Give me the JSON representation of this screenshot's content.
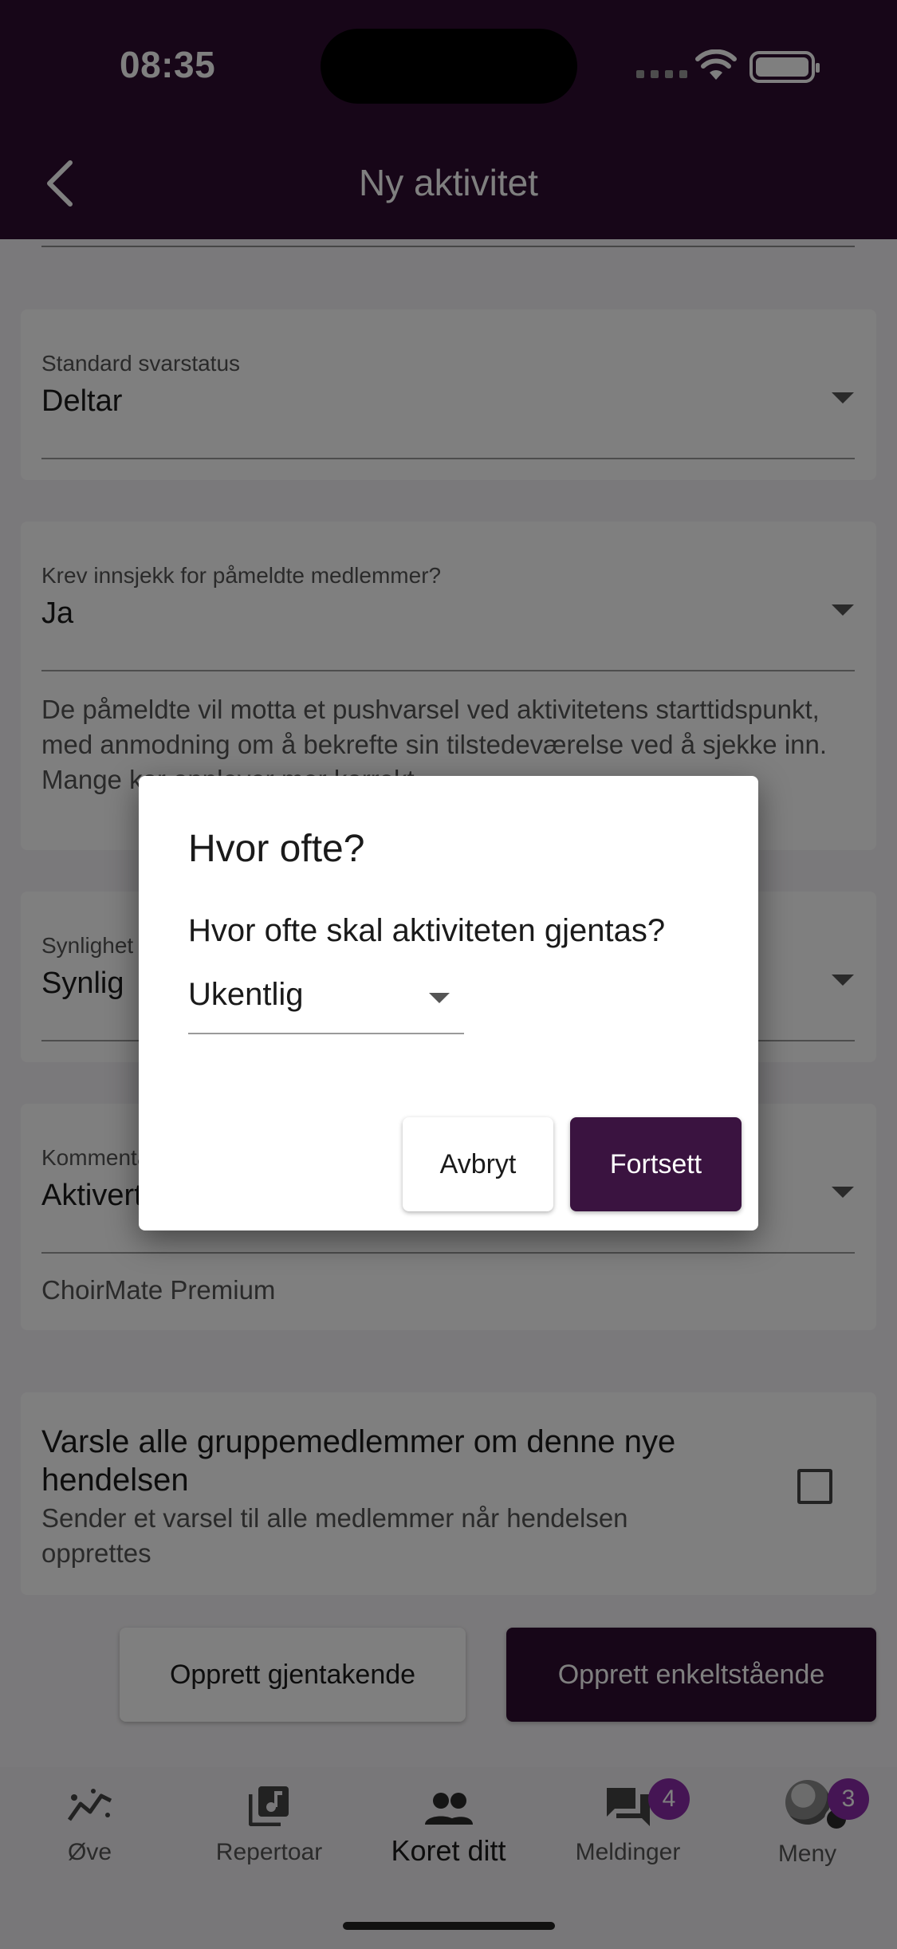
{
  "status_bar": {
    "time": "08:35"
  },
  "app_bar": {
    "title": "Ny aktivitet"
  },
  "form": {
    "default_response": {
      "label": "Standard svarstatus",
      "value": "Deltar"
    },
    "checkin": {
      "label": "Krev innsjekk for påmeldte medlemmer?",
      "value": "Ja",
      "helper": "De påmeldte vil motta et pushvarsel ved aktivitetens starttidspunkt, med anmodning om å bekrefte sin tilstedeværelse ved å sjekke inn. Mange kor opplever mer korrekt"
    },
    "visibility": {
      "label": "Synlighet",
      "value": "Synlig"
    },
    "comments": {
      "label": "Kommentarer",
      "value": "Aktivert",
      "helper": "ChoirMate Premium"
    },
    "notify": {
      "title": "Varsle alle gruppemedlemmer om denne nye hendelsen",
      "subtitle": "Sender et varsel til alle medlemmer når hendelsen opprettes",
      "checked": false
    }
  },
  "actions": {
    "create_recurring": "Opprett gjentakende",
    "create_single": "Opprett enkeltstående"
  },
  "bottom_nav": {
    "items": [
      {
        "label": "Øve",
        "icon": "practice-chart-icon"
      },
      {
        "label": "Repertoar",
        "icon": "music-library-icon"
      },
      {
        "label": "Koret ditt",
        "icon": "group-icon",
        "active": true
      },
      {
        "label": "Meldinger",
        "icon": "chat-icon",
        "badge": "4"
      },
      {
        "label": "Meny",
        "icon": "avatar",
        "badge": "3"
      }
    ]
  },
  "dialog": {
    "title": "Hvor ofte?",
    "question": "Hvor ofte skal aktiviteten gjentas?",
    "frequency": "Ukentlig",
    "cancel": "Avbryt",
    "continue": "Fortsett"
  },
  "colors": {
    "primary": "#2e0c30",
    "badge": "#8a2aa8",
    "background": "#f5f3f6"
  }
}
